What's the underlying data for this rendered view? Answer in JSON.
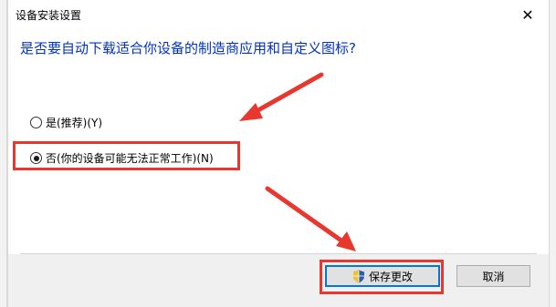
{
  "dialog": {
    "title": "设备安装设置",
    "close_glyph": "✕",
    "question": "是否要自动下载适合你设备的制造商应用和自定义图标?",
    "options": [
      {
        "label": "是(推荐)(Y)",
        "checked": false
      },
      {
        "label": "否(你的设备可能无法正常工作)(N)",
        "checked": true
      }
    ],
    "buttons": {
      "save_label": "保存更改",
      "save_icon": "shield-icon",
      "cancel_label": "取消"
    }
  },
  "annotations": {
    "highlight_color": "#e8372f"
  }
}
